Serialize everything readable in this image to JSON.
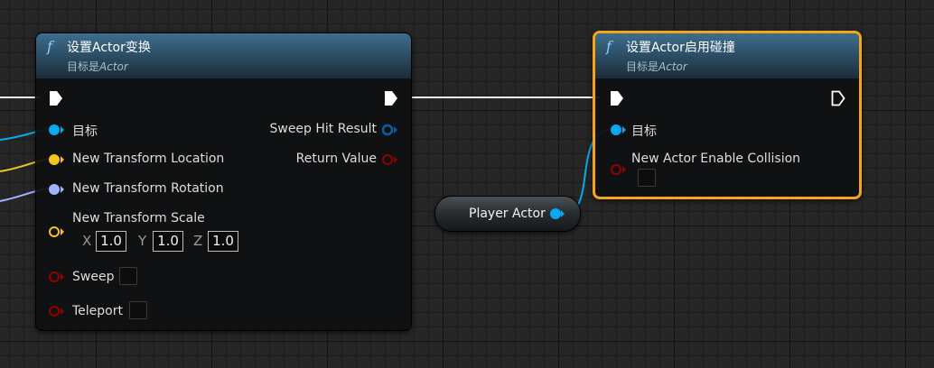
{
  "colors": {
    "exec": "#ffffff",
    "object": "#09a8f0",
    "vector": "#f2c51f",
    "rotator": "#9fb3ff",
    "transform": "#f2a500",
    "bool": "#930000",
    "struct": "#0a5ea8",
    "selected_outline": "#f3a51c"
  },
  "node_set_transform": {
    "func_icon": "f",
    "title": "设置Actor变换",
    "subtitle_prefix": "目标是",
    "subtitle_target": "Actor",
    "input_pins": [
      {
        "label": "目标",
        "type": "object",
        "icon": "filled-circle-pin"
      },
      {
        "label": "New Transform Location",
        "type": "vector",
        "icon": "filled-circle-pin"
      },
      {
        "label": "New Transform Rotation",
        "type": "rotator",
        "icon": "filled-circle-pin"
      },
      {
        "label": "New Transform Scale",
        "type": "vector",
        "icon": "hollow-circle-pin"
      },
      {
        "label": "Sweep",
        "type": "bool",
        "icon": "hollow-circle-pin",
        "checked": false
      },
      {
        "label": "Teleport",
        "type": "bool",
        "icon": "hollow-circle-pin",
        "checked": false
      }
    ],
    "scale": {
      "x_label": "X",
      "x": "1.0",
      "y_label": "Y",
      "y": "1.0",
      "z_label": "Z",
      "z": "1.0"
    },
    "output_pins": [
      {
        "label": "Sweep Hit Result",
        "type": "struct"
      },
      {
        "label": "Return Value",
        "type": "bool"
      }
    ]
  },
  "node_enable_collision": {
    "func_icon": "f",
    "title": "设置Actor启用碰撞",
    "subtitle_prefix": "目标是",
    "subtitle_target": "Actor",
    "input_pins": [
      {
        "label": "目标",
        "type": "object"
      },
      {
        "label": "New Actor Enable Collision",
        "type": "bool",
        "checked": false
      }
    ]
  },
  "var_node": {
    "label": "Player Actor",
    "type": "object"
  }
}
